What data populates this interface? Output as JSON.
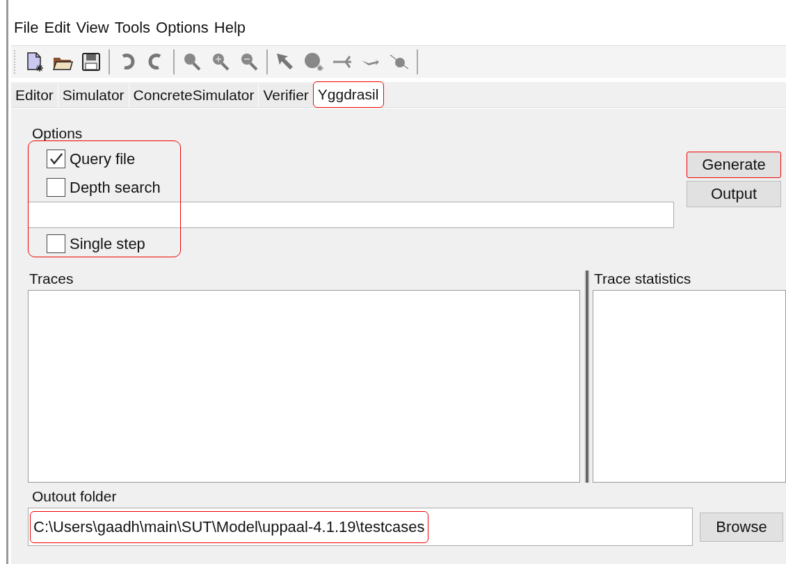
{
  "menu": [
    "File",
    "Edit",
    "View",
    "Tools",
    "Options",
    "Help"
  ],
  "toolbar": [
    {
      "kind": "new"
    },
    {
      "kind": "open"
    },
    {
      "kind": "save"
    },
    {
      "kind": "sep"
    },
    {
      "kind": "undo"
    },
    {
      "kind": "redo"
    },
    {
      "kind": "sep"
    },
    {
      "kind": "zoom"
    },
    {
      "kind": "zoomin"
    },
    {
      "kind": "zoomout"
    },
    {
      "kind": "sep"
    },
    {
      "kind": "select"
    },
    {
      "kind": "location"
    },
    {
      "kind": "branch"
    },
    {
      "kind": "edge"
    },
    {
      "kind": "nail"
    },
    {
      "kind": "sep"
    }
  ],
  "tabs": [
    {
      "label": "Editor",
      "selected": false,
      "highlighted": false
    },
    {
      "label": "Simulator",
      "selected": false,
      "highlighted": false
    },
    {
      "label": "ConcreteSimulator",
      "selected": false,
      "highlighted": false
    },
    {
      "label": "Verifier",
      "selected": false,
      "highlighted": false
    },
    {
      "label": "Yggdrasil",
      "selected": true,
      "highlighted": true
    }
  ],
  "options": {
    "title": "Options",
    "highlighted": true,
    "checkboxes": [
      {
        "label": "Query file",
        "checked": true
      },
      {
        "label": "Depth search",
        "checked": false
      }
    ],
    "single_step": {
      "label": "Single step",
      "checked": false
    }
  },
  "buttons": [
    {
      "label": "Generate",
      "highlighted": true
    },
    {
      "label": "Output",
      "highlighted": false
    }
  ],
  "traces": {
    "title": "Traces"
  },
  "trace_statistics": {
    "title": "Trace statistics"
  },
  "output_folder": {
    "title": "Outout folder",
    "value": "C:\\Users\\gaadh\\main\\SUT\\Model\\uppaal-4.1.19\\testcases",
    "highlighted": true,
    "button": "Browse"
  }
}
